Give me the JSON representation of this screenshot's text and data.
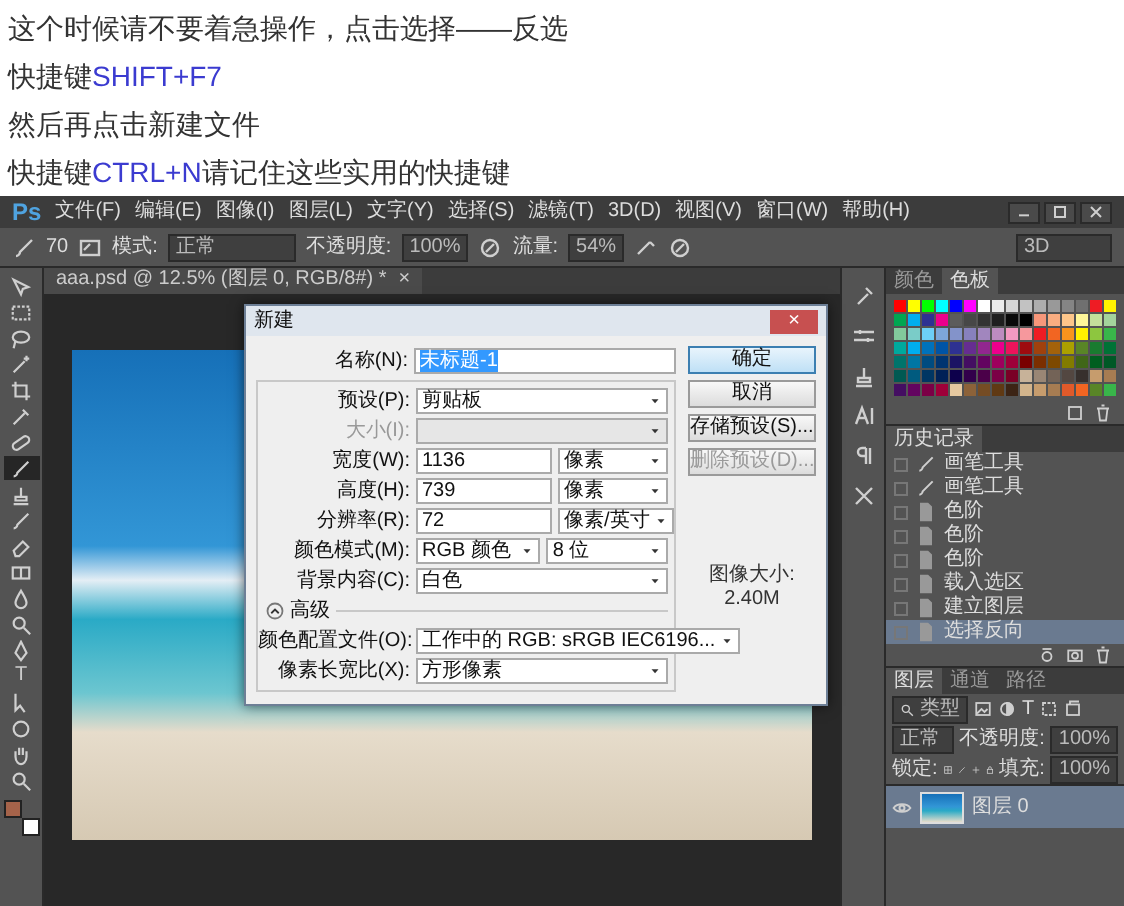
{
  "intro": [
    {
      "parts": [
        {
          "text": "这个时候请不要着急操作，点击选择——反选",
          "highlight": false
        }
      ]
    },
    {
      "parts": [
        {
          "text": "快捷键",
          "highlight": false
        },
        {
          "text": "SHIFT+F7",
          "highlight": true
        }
      ]
    },
    {
      "parts": [
        {
          "text": "然后再点击新建文件",
          "highlight": false
        }
      ]
    },
    {
      "parts": [
        {
          "text": "快捷键",
          "highlight": false
        },
        {
          "text": "CTRL+N",
          "highlight": true
        },
        {
          "text": "请记住这些实用的快捷键",
          "highlight": false
        }
      ]
    }
  ],
  "app": {
    "logo": "Ps",
    "menus": [
      "文件(F)",
      "编辑(E)",
      "图像(I)",
      "图层(L)",
      "文字(Y)",
      "选择(S)",
      "滤镜(T)",
      "3D(D)",
      "视图(V)",
      "窗口(W)",
      "帮助(H)"
    ]
  },
  "options": {
    "brush_size": "70",
    "mode_label": "模式:",
    "mode": "正常",
    "opacity_label": "不透明度:",
    "opacity": "100%",
    "flow_label": "流量:",
    "flow": "54%",
    "workspace": "3D"
  },
  "document_tab": {
    "title": "aaa.psd @ 12.5% (图层 0, RGB/8#) *",
    "close": "×"
  },
  "tools": [
    {
      "kind": "move",
      "selected": false
    },
    {
      "kind": "marquee",
      "selected": false
    },
    {
      "kind": "lasso",
      "selected": false
    },
    {
      "kind": "wand",
      "selected": false
    },
    {
      "kind": "crop",
      "selected": false
    },
    {
      "kind": "eyedropper",
      "selected": false
    },
    {
      "kind": "bandage",
      "selected": false
    },
    {
      "kind": "brush",
      "selected": true
    },
    {
      "kind": "stamp",
      "selected": false
    },
    {
      "kind": "brush",
      "selected": false
    },
    {
      "kind": "eraser",
      "selected": false
    },
    {
      "kind": "gradient",
      "selected": false
    },
    {
      "kind": "drop",
      "selected": false
    },
    {
      "kind": "magnifier",
      "selected": false
    },
    {
      "kind": "pen",
      "selected": false
    },
    {
      "kind": "type",
      "glyph": "T",
      "selected": false
    },
    {
      "kind": "pointer",
      "selected": false
    },
    {
      "kind": "shape",
      "selected": false
    },
    {
      "kind": "hand",
      "selected": false
    },
    {
      "kind": "magnifier",
      "selected": false
    }
  ],
  "tool_colors": [
    {
      "color": "#a5634a"
    },
    {
      "color": "#ffffff"
    }
  ],
  "dialog": {
    "title": "新建",
    "close": "×",
    "name_label": "名称(N):",
    "name_value": "未标题-1",
    "preset_label": "预设(P):",
    "preset": "剪贴板",
    "rows": [
      {
        "kind": "select",
        "label": "大小(I):",
        "disabled": true
      },
      {
        "kind": "number",
        "label": "宽度(W):",
        "value": "1136",
        "unit": "像素",
        "disabled": false
      },
      {
        "kind": "number",
        "label": "高度(H):",
        "value": "739",
        "unit": "像素",
        "disabled": false
      },
      {
        "kind": "number",
        "label": "分辨率(R):",
        "value": "72",
        "unit": "像素/英寸",
        "disabled": false
      },
      {
        "kind": "pair",
        "label": "颜色模式(M):",
        "value": "RGB 颜色",
        "unit": "8 位",
        "disabled": false
      },
      {
        "kind": "select",
        "label": "背景内容(C):",
        "value": "白色",
        "disabled": false
      }
    ],
    "advanced_label": "高级",
    "advanced_expanded": true,
    "advanced_rows": [
      {
        "label": "颜色配置文件(O):",
        "value": "工作中的 RGB: sRGB IEC6196..."
      },
      {
        "label": "像素长宽比(X):",
        "value": "方形像素"
      }
    ],
    "buttons": [
      {
        "label": "确定",
        "default": true,
        "disabled": false
      },
      {
        "label": "取消",
        "default": false,
        "disabled": false
      },
      {
        "label": "存储预设(S)...",
        "default": false,
        "disabled": false
      },
      {
        "label": "删除预设(D)...",
        "default": false,
        "disabled": true
      }
    ],
    "image_size_label": "图像大小:",
    "image_size": "2.40M"
  },
  "swatch_panel": {
    "tabs": [
      {
        "label": "颜色",
        "selected": false
      },
      {
        "label": "色板",
        "selected": true
      }
    ],
    "rows": [
      [
        {
          "color": "#ff0000"
        },
        {
          "color": "#ffff00"
        },
        {
          "color": "#00ff00"
        },
        {
          "color": "#00ffff"
        },
        {
          "color": "#0000ff"
        },
        {
          "color": "#ff00ff"
        },
        {
          "color": "#ffffff"
        },
        {
          "color": "#ebebeb"
        },
        {
          "color": "#d6d6d6"
        },
        {
          "color": "#c2c2c2"
        },
        {
          "color": "#adadad"
        },
        {
          "color": "#999999"
        },
        {
          "color": "#858585"
        },
        {
          "color": "#707070"
        },
        {
          "color": "#ee1c24"
        },
        {
          "color": "#fff200"
        }
      ],
      [
        {
          "color": "#00a651"
        },
        {
          "color": "#00aeef"
        },
        {
          "color": "#2e3192"
        },
        {
          "color": "#ec008c"
        },
        {
          "color": "#5c5c5c"
        },
        {
          "color": "#474747"
        },
        {
          "color": "#333333"
        },
        {
          "color": "#1f1f1f"
        },
        {
          "color": "#0a0a0a"
        },
        {
          "color": "#000000"
        },
        {
          "color": "#f7977a"
        },
        {
          "color": "#f9ad81"
        },
        {
          "color": "#fdc68a"
        },
        {
          "color": "#fff799"
        },
        {
          "color": "#c4df9b"
        },
        {
          "color": "#a3d39c"
        }
      ],
      [
        {
          "color": "#82ca9c"
        },
        {
          "color": "#7accc8"
        },
        {
          "color": "#6dcff6"
        },
        {
          "color": "#7da7d9"
        },
        {
          "color": "#8393ca"
        },
        {
          "color": "#8781bd"
        },
        {
          "color": "#a186be"
        },
        {
          "color": "#bd8cbf"
        },
        {
          "color": "#f49ac1"
        },
        {
          "color": "#f6989d"
        },
        {
          "color": "#ed1c24"
        },
        {
          "color": "#f26522"
        },
        {
          "color": "#f7941d"
        },
        {
          "color": "#fff200"
        },
        {
          "color": "#8dc63f"
        },
        {
          "color": "#39b54a"
        }
      ],
      [
        {
          "color": "#00a99d"
        },
        {
          "color": "#00aeef"
        },
        {
          "color": "#0072bc"
        },
        {
          "color": "#0054a6"
        },
        {
          "color": "#2e3192"
        },
        {
          "color": "#662d91"
        },
        {
          "color": "#92278f"
        },
        {
          "color": "#ec008c"
        },
        {
          "color": "#ed145b"
        },
        {
          "color": "#9e0b0f"
        },
        {
          "color": "#a0410d"
        },
        {
          "color": "#a3620a"
        },
        {
          "color": "#aba000"
        },
        {
          "color": "#598527"
        },
        {
          "color": "#197b30"
        },
        {
          "color": "#007236"
        }
      ],
      [
        {
          "color": "#00746b"
        },
        {
          "color": "#0076a3"
        },
        {
          "color": "#004b80"
        },
        {
          "color": "#003471"
        },
        {
          "color": "#1b1464"
        },
        {
          "color": "#440e62"
        },
        {
          "color": "#630460"
        },
        {
          "color": "#9e005d"
        },
        {
          "color": "#9e0039"
        },
        {
          "color": "#790000"
        },
        {
          "color": "#7b2e00"
        },
        {
          "color": "#7d4900"
        },
        {
          "color": "#827b00"
        },
        {
          "color": "#406618"
        },
        {
          "color": "#005e20"
        },
        {
          "color": "#005826"
        }
      ],
      [
        {
          "color": "#005952"
        },
        {
          "color": "#005b7f"
        },
        {
          "color": "#003663"
        },
        {
          "color": "#002157"
        },
        {
          "color": "#0d004c"
        },
        {
          "color": "#32004b"
        },
        {
          "color": "#4b0049"
        },
        {
          "color": "#7b0046"
        },
        {
          "color": "#7a0026"
        },
        {
          "color": "#c7b299"
        },
        {
          "color": "#998675"
        },
        {
          "color": "#736357"
        },
        {
          "color": "#534741"
        },
        {
          "color": "#37302d"
        },
        {
          "color": "#c69c6d"
        },
        {
          "color": "#a67c52"
        }
      ],
      [
        {
          "color": "#440e62"
        },
        {
          "color": "#630460"
        },
        {
          "color": "#7b0046"
        },
        {
          "color": "#9e0039"
        },
        {
          "color": "#e6c9a0"
        },
        {
          "color": "#8c6239"
        },
        {
          "color": "#754c24"
        },
        {
          "color": "#603913"
        },
        {
          "color": "#3c2415"
        },
        {
          "color": "#d2b48c"
        },
        {
          "color": "#c69c6d"
        },
        {
          "color": "#a67c52"
        },
        {
          "color": "#e05a2a"
        },
        {
          "color": "#f26522"
        },
        {
          "color": "#598527"
        },
        {
          "color": "#39b54a"
        }
      ]
    ]
  },
  "history_panel": {
    "title": "历史记录",
    "items": [
      {
        "kind": "brush",
        "label": "画笔工具",
        "selected": false
      },
      {
        "kind": "brush",
        "label": "画笔工具",
        "selected": false
      },
      {
        "kind": "doc",
        "label": "色阶",
        "selected": false
      },
      {
        "kind": "doc",
        "label": "色阶",
        "selected": false
      },
      {
        "kind": "doc",
        "label": "色阶",
        "selected": false
      },
      {
        "kind": "doc",
        "label": "载入选区",
        "selected": false
      },
      {
        "kind": "doc",
        "label": "建立图层",
        "selected": false
      },
      {
        "kind": "doc",
        "label": "选择反向",
        "selected": true
      }
    ]
  },
  "layers_panel": {
    "tabs": [
      {
        "label": "图层",
        "selected": true
      },
      {
        "label": "通道",
        "selected": false
      },
      {
        "label": "路径",
        "selected": false
      }
    ],
    "filter": "类型",
    "filter_glyph": "T",
    "blend_mode": "正常",
    "opacity_label": "不透明度:",
    "opacity": "100%",
    "lock_label": "锁定:",
    "fill_label": "填充:",
    "fill": "100%",
    "layers": [
      {
        "name": "图层 0",
        "visible": true,
        "selected": true
      }
    ]
  }
}
